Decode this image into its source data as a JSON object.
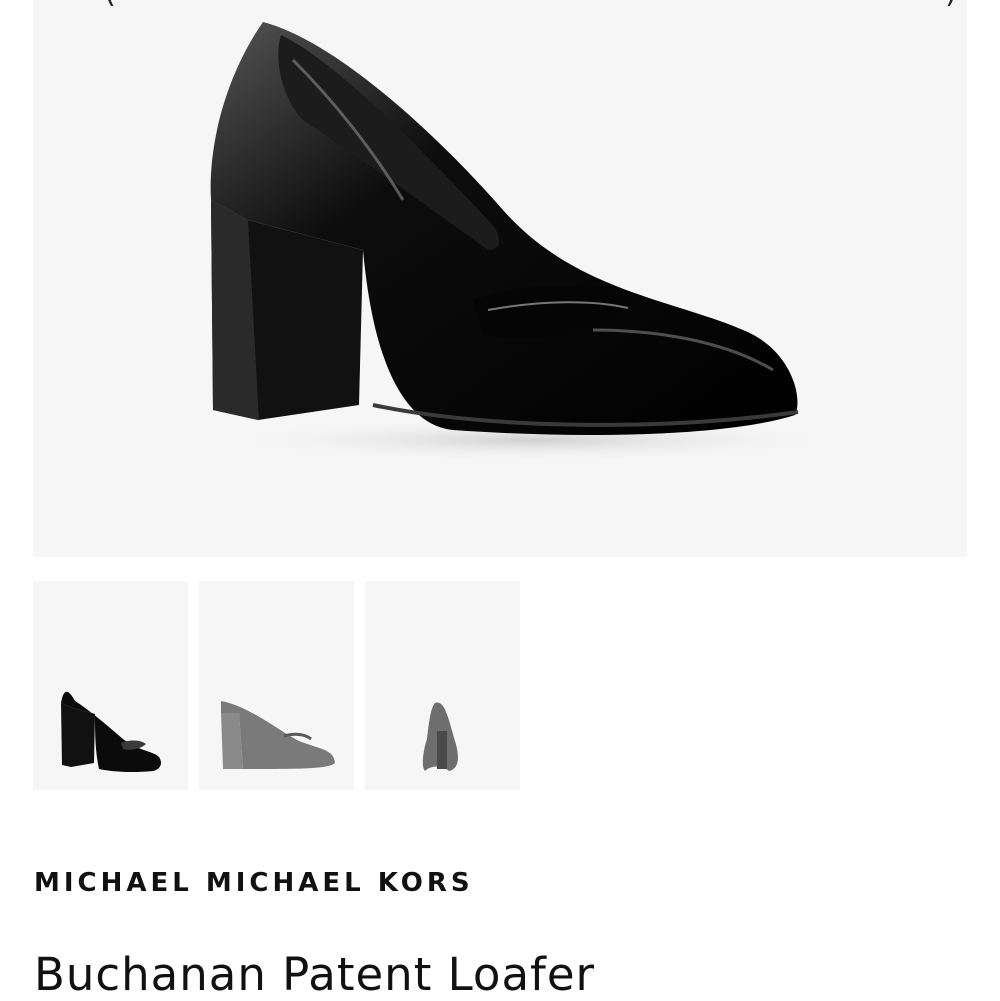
{
  "gallery": {
    "prev_icon": "left-paren-arrow",
    "prev_glyph": "(",
    "next_icon": "right-paren-arrow",
    "next_glyph": ")",
    "thumbnails": [
      {
        "view": "side-angle",
        "selected": true
      },
      {
        "view": "side-profile",
        "selected": false
      },
      {
        "view": "front",
        "selected": false
      }
    ]
  },
  "product": {
    "brand": "MICHAEL MICHAEL KORS",
    "name": "Buchanan Patent Loafer"
  },
  "colors": {
    "background": "#ffffff",
    "image_bg": "#f6f6f6",
    "shoe": "#0b0b0b",
    "text": "#111111"
  }
}
